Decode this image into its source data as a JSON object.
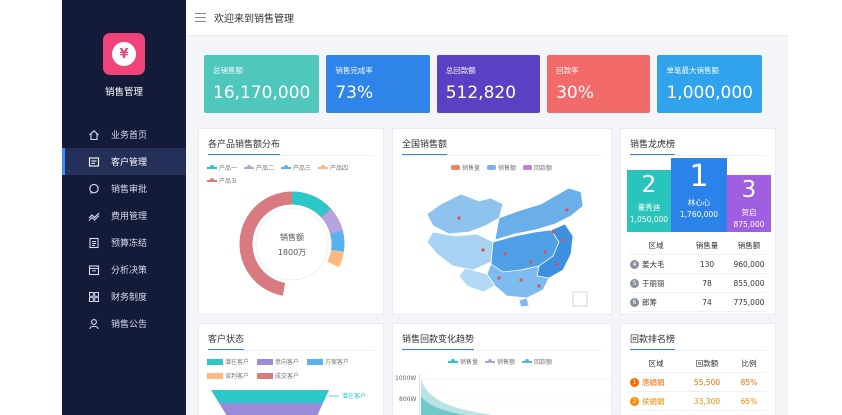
{
  "app": {
    "name": "销售管理",
    "logo_glyph": "¥"
  },
  "topbar": {
    "welcome": "欢迎来到销售管理"
  },
  "sidebar": {
    "items": [
      {
        "label": "业务首页",
        "icon": "home-icon"
      },
      {
        "label": "客户管理",
        "icon": "customer-icon",
        "active": true
      },
      {
        "label": "销售审批",
        "icon": "chat-icon"
      },
      {
        "label": "费用管理",
        "icon": "trend-icon"
      },
      {
        "label": "预算冻结",
        "icon": "doc-icon"
      },
      {
        "label": "分析决策",
        "icon": "calendar-icon"
      },
      {
        "label": "财务制度",
        "icon": "grid-icon"
      },
      {
        "label": "销售公告",
        "icon": "user-icon"
      }
    ]
  },
  "kpis": [
    {
      "label": "总销售额",
      "value": "16,170,000",
      "color": "#4fc7bd"
    },
    {
      "label": "销售完成率",
      "value": "73%",
      "color": "#2f84ea"
    },
    {
      "label": "总回款额",
      "value": "512,820",
      "color": "#5b40c3"
    },
    {
      "label": "回款率",
      "value": "30%",
      "color": "#f26a6a"
    },
    {
      "label": "单笔最大销售额",
      "value": "1,000,000",
      "color": "#30a3ec"
    }
  ],
  "cards": {
    "product_dist": {
      "title": "各产品销售额分布"
    },
    "national": {
      "title": "全国销售额"
    },
    "leaderboard": {
      "title": "销售龙虎榜"
    },
    "customer_status": {
      "title": "客户状态"
    },
    "trend": {
      "title": "销售回款变化趋势"
    },
    "collection_rank": {
      "title": "回款排名榜"
    }
  },
  "donut": {
    "legend": [
      {
        "name": "产品一",
        "color": "#2ec7c9"
      },
      {
        "name": "产品二",
        "color": "#b6a2de"
      },
      {
        "name": "产品三",
        "color": "#5ab1ef"
      },
      {
        "name": "产品四",
        "color": "#ffb980"
      },
      {
        "name": "产品五",
        "color": "#d87a80"
      }
    ],
    "center_label": "销售额",
    "center_value": "1800万"
  },
  "map_legend": [
    {
      "name": "销售量",
      "color": "#f0845a"
    },
    {
      "name": "销售额",
      "color": "#7fb3f0"
    },
    {
      "name": "回款额",
      "color": "#c57fd8"
    }
  ],
  "leaderboard": {
    "podium": [
      {
        "rank": "2",
        "name": "董秀迪",
        "value": "1,050,000",
        "color": "#29c4bc"
      },
      {
        "rank": "1",
        "name": "林心心",
        "value": "1,760,000",
        "color": "#2b82e8"
      },
      {
        "rank": "3",
        "name": "贺启",
        "value": "875,000",
        "color": "#9f5fe0"
      }
    ],
    "headers": [
      "区域",
      "销售量",
      "销售额"
    ],
    "rows": [
      {
        "no": "4",
        "name": "姜大毛",
        "qty": "130",
        "amount": "960,000"
      },
      {
        "no": "5",
        "name": "于丽丽",
        "qty": "78",
        "amount": "855,000"
      },
      {
        "no": "6",
        "name": "郎筹",
        "qty": "74",
        "amount": "775,000"
      }
    ]
  },
  "customer_status": {
    "legend": [
      {
        "name": "潜在客户",
        "color": "#2ec7c9"
      },
      {
        "name": "意向客户",
        "color": "#9b8ad8"
      },
      {
        "name": "方案客户",
        "color": "#5ab1ef"
      },
      {
        "name": "谈判客户",
        "color": "#ffb980"
      },
      {
        "name": "成交客户",
        "color": "#d87a80"
      }
    ],
    "funnel_label": "潜在客户"
  },
  "trend": {
    "legend": [
      {
        "name": "销售量",
        "color": "#2ec7c9"
      },
      {
        "name": "销售额",
        "color": "#b6a2de"
      },
      {
        "name": "回款额",
        "color": "#5ab1ef"
      }
    ],
    "y_ticks": [
      "1000W",
      "800W"
    ]
  },
  "collection_rank": {
    "headers": [
      "区域",
      "回款额",
      "比例"
    ],
    "rows": [
      {
        "no": "1",
        "name": "唐娟娟",
        "amount": "55,500",
        "ratio": "85%",
        "color": "#ff6a00"
      },
      {
        "no": "2",
        "name": "侯娟娟",
        "amount": "33,300",
        "ratio": "65%",
        "color": "#ff8a00"
      },
      {
        "no": "3",
        "name": "",
        "amount": "",
        "ratio": "",
        "color": "#ffa200"
      }
    ]
  }
}
